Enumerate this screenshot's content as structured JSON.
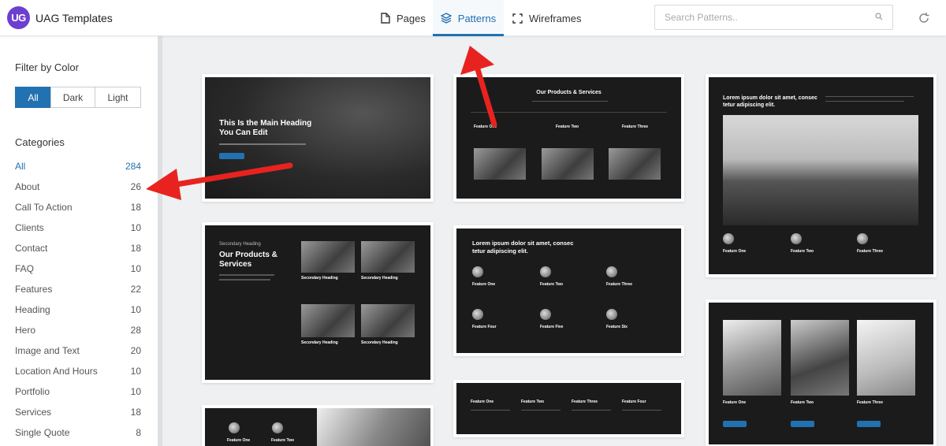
{
  "app": {
    "logo": "UG",
    "title": "UAG Templates"
  },
  "tabs": [
    {
      "label": "Pages",
      "icon": "page-icon"
    },
    {
      "label": "Patterns",
      "icon": "layers-icon",
      "active": true
    },
    {
      "label": "Wireframes",
      "icon": "wireframe-icon"
    }
  ],
  "search": {
    "placeholder": "Search Patterns.."
  },
  "sidebar": {
    "filter_title": "Filter by Color",
    "color_options": [
      "All",
      "Dark",
      "Light"
    ],
    "categories_title": "Categories",
    "categories": [
      {
        "name": "All",
        "count": "284"
      },
      {
        "name": "About",
        "count": "26"
      },
      {
        "name": "Call To Action",
        "count": "18"
      },
      {
        "name": "Clients",
        "count": "10"
      },
      {
        "name": "Contact",
        "count": "18"
      },
      {
        "name": "FAQ",
        "count": "10"
      },
      {
        "name": "Features",
        "count": "22"
      },
      {
        "name": "Heading",
        "count": "10"
      },
      {
        "name": "Hero",
        "count": "28"
      },
      {
        "name": "Image and Text",
        "count": "20"
      },
      {
        "name": "Location And Hours",
        "count": "10"
      },
      {
        "name": "Portfolio",
        "count": "10"
      },
      {
        "name": "Services",
        "count": "18"
      },
      {
        "name": "Single Quote",
        "count": "8"
      }
    ]
  },
  "patterns": {
    "hero": {
      "heading": "This Is the Main Heading You Can Edit"
    },
    "products": {
      "heading": "Our Products & Services",
      "features": [
        "Feature One",
        "Feature Two",
        "Feature Three"
      ]
    },
    "city": {
      "heading": "Lorem ipsum dolor sit amet, consec tetur adipiscing elit.",
      "features": [
        "Feature One",
        "Feature Two",
        "Feature Three"
      ]
    },
    "services": {
      "kicker": "Secondary Heading",
      "heading": "Our Products & Services",
      "items": [
        "Secondary Heading",
        "Secondary Heading",
        "Secondary Heading",
        "Secondary Heading"
      ]
    },
    "six": {
      "heading": "Lorem ipsum dolor sit amet, consec tetur adipiscing elit.",
      "features": [
        "Feature One",
        "Feature Two",
        "Feature Three",
        "Feature Four",
        "Feature Five",
        "Feature Six"
      ]
    },
    "four": {
      "features": [
        "Feature One",
        "Feature Two",
        "Feature Three",
        "Feature Four"
      ]
    },
    "plants": {
      "features": [
        "Feature One",
        "Feature Two",
        "Feature Three"
      ]
    },
    "bottom": {
      "features": [
        "Feature One",
        "Feature Two"
      ]
    }
  },
  "colors": {
    "accent": "#2271b1",
    "arrow": "#e8231f",
    "logo": "#6b3fd1"
  }
}
